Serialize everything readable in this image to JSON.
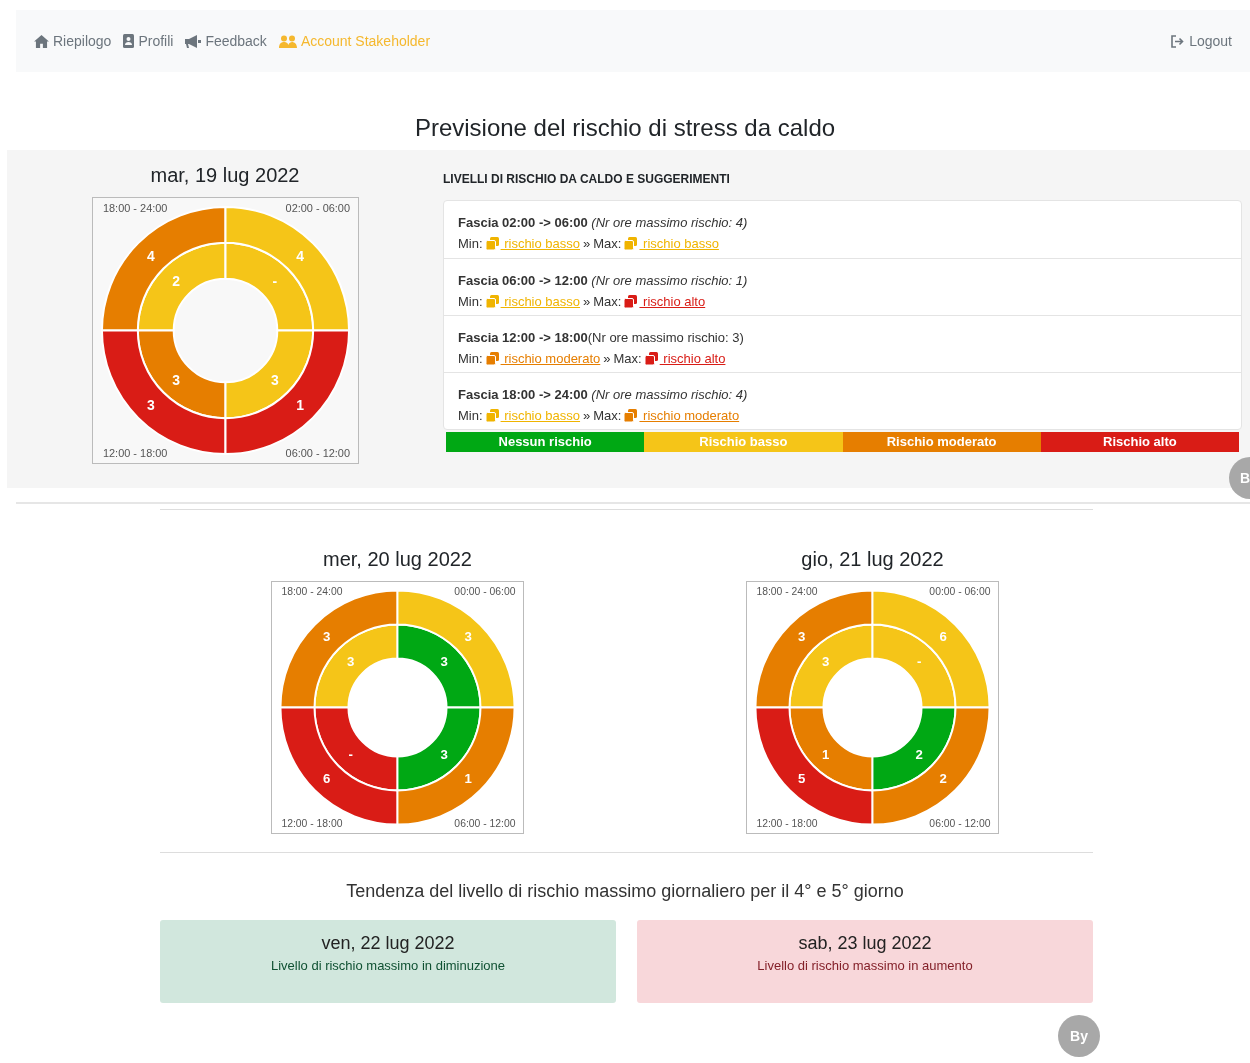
{
  "nav": {
    "items": [
      {
        "label": "Riepilogo",
        "selected": false
      },
      {
        "label": "Profili",
        "selected": false
      },
      {
        "label": "Feedback",
        "selected": false
      },
      {
        "label": "Account Stakeholder",
        "selected": true
      }
    ],
    "logout": "Logout"
  },
  "title": "Previsione del rischio di stress da caldo",
  "today": {
    "date": "mar, 19 lug 2022",
    "quadrants": [
      {
        "label": "18:00 - 24:00",
        "outer": {
          "color": "#e67e00",
          "value": "4"
        },
        "inner": {
          "color": "#f5c518",
          "value": "2"
        }
      },
      {
        "label": "02:00 - 06:00",
        "outer": {
          "color": "#f5c518",
          "value": "4"
        },
        "inner": {
          "color": "#f5c518",
          "value": "-"
        }
      },
      {
        "label": "12:00 - 18:00",
        "outer": {
          "color": "#d91c16",
          "value": "3"
        },
        "inner": {
          "color": "#e67e00",
          "value": "3"
        }
      },
      {
        "label": "06:00 - 12:00",
        "outer": {
          "color": "#d91c16",
          "value": "1"
        },
        "inner": {
          "color": "#f5c518",
          "value": "3"
        }
      }
    ]
  },
  "suggestions": {
    "heading": "LIVELLI DI RISCHIO DA CALDO E SUGGERIMENTI",
    "items": [
      {
        "band": "Fascia 02:00 -> 06:00",
        "note": " (Nr ore massimo rischio: 4)",
        "italic": true,
        "min_label": "Min:",
        "min": {
          "color": "#f0b400",
          "text": " rischio basso"
        },
        "sep": "»",
        "max_label": "Max:",
        "max": {
          "color": "#f0b400",
          "text": " rischio basso"
        }
      },
      {
        "band": "Fascia 06:00 -> 12:00",
        "note": " (Nr ore massimo rischio: 1)",
        "italic": true,
        "min_label": "Min:",
        "min": {
          "color": "#f0b400",
          "text": " rischio basso"
        },
        "sep": "»",
        "max_label": "Max:",
        "max": {
          "color": "#d91c16",
          "text": " rischio alto"
        }
      },
      {
        "band": "Fascia 12:00 -> 18:00",
        "note": "(Nr ore massimo rischio: 3)",
        "italic": false,
        "min_label": "Min:",
        "min": {
          "color": "#e67e00",
          "text": " rischio moderato"
        },
        "sep": "»",
        "max_label": "Max:",
        "max": {
          "color": "#d91c16",
          "text": " rischio alto"
        }
      },
      {
        "band": "Fascia 18:00 -> 24:00",
        "note": " (Nr ore massimo rischio: 4)",
        "italic": true,
        "min_label": "Min:",
        "min": {
          "color": "#f0b400",
          "text": " rischio basso"
        },
        "sep": "»",
        "max_label": "Max:",
        "max": {
          "color": "#e67e00",
          "text": " rischio moderato"
        }
      }
    ],
    "legend": [
      {
        "color": "#00a814",
        "label": "Nessun rischio"
      },
      {
        "color": "#f5c518",
        "label": "Rischio basso"
      },
      {
        "color": "#e67e00",
        "label": "Rischio moderato"
      },
      {
        "color": "#d91c16",
        "label": "Rischio alto"
      }
    ]
  },
  "days": [
    {
      "date": "mer, 20 lug 2022",
      "quadrants": [
        {
          "label": "18:00 - 24:00",
          "outer": {
            "color": "#e67e00",
            "value": "3"
          },
          "inner": {
            "color": "#f5c518",
            "value": "3"
          }
        },
        {
          "label": "00:00 - 06:00",
          "outer": {
            "color": "#f5c518",
            "value": "3"
          },
          "inner": {
            "color": "#00a814",
            "value": "3"
          }
        },
        {
          "label": "12:00 - 18:00",
          "outer": {
            "color": "#d91c16",
            "value": "6"
          },
          "inner": {
            "color": "#d91c16",
            "value": "-"
          }
        },
        {
          "label": "06:00 - 12:00",
          "outer": {
            "color": "#e67e00",
            "value": "1"
          },
          "inner": {
            "color": "#00a814",
            "value": "3"
          }
        }
      ]
    },
    {
      "date": "gio, 21 lug 2022",
      "quadrants": [
        {
          "label": "18:00 - 24:00",
          "outer": {
            "color": "#e67e00",
            "value": "3"
          },
          "inner": {
            "color": "#f5c518",
            "value": "3"
          }
        },
        {
          "label": "00:00 - 06:00",
          "outer": {
            "color": "#f5c518",
            "value": "6"
          },
          "inner": {
            "color": "#f5c518",
            "value": "-"
          }
        },
        {
          "label": "12:00 - 18:00",
          "outer": {
            "color": "#d91c16",
            "value": "5"
          },
          "inner": {
            "color": "#e67e00",
            "value": "1"
          }
        },
        {
          "label": "06:00 - 12:00",
          "outer": {
            "color": "#e67e00",
            "value": "2"
          },
          "inner": {
            "color": "#00a814",
            "value": "2"
          }
        }
      ]
    }
  ],
  "trend": {
    "heading": "Tendenza del livello di rischio massimo giornaliero per il 4° e 5° giorno",
    "items": [
      {
        "kind": "decrease",
        "date": "ven, 22 lug 2022",
        "text": "Livello di rischio massimo in diminuzione"
      },
      {
        "kind": "increase",
        "date": "sab, 23 lug 2022",
        "text": "Livello di rischio massimo in aumento"
      }
    ]
  },
  "badges": [
    "B",
    "By"
  ]
}
